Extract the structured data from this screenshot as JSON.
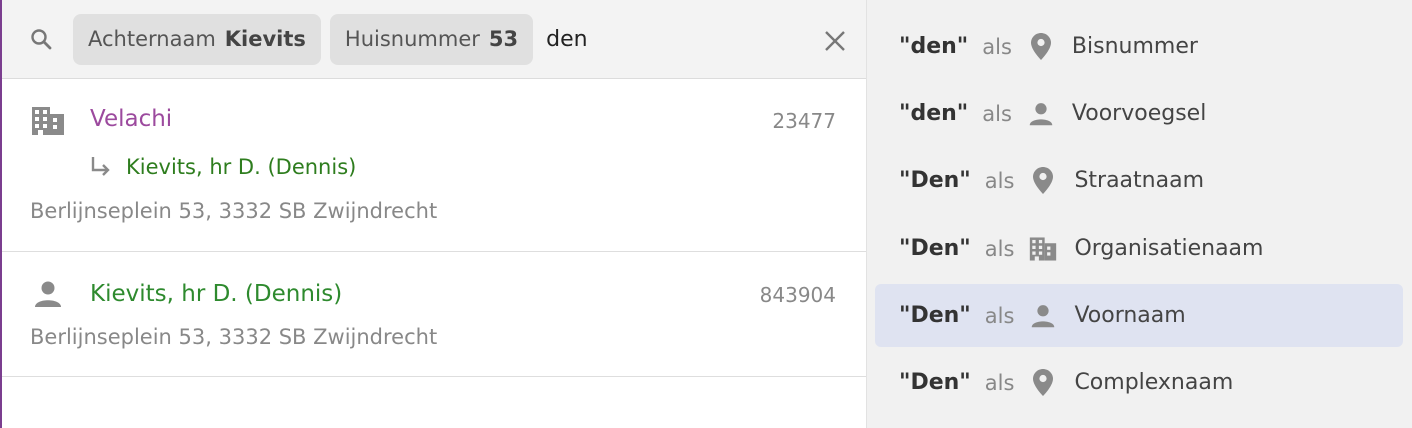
{
  "search": {
    "chips": [
      {
        "label": "Achternaam",
        "value": "Kievits"
      },
      {
        "label": "Huisnummer",
        "value": "53"
      }
    ],
    "query": "den"
  },
  "results": [
    {
      "icon": "building-icon",
      "title": "Velachi",
      "id": "23477",
      "contact": "Kievits, hr D. (Dennis)",
      "address": "Berlijnseplein 53, 3332 SB Zwijndrecht"
    },
    {
      "icon": "person-icon",
      "title": "Kievits, hr D. (Dennis)",
      "id": "843904",
      "address": "Berlijnseplein 53, 3332 SB Zwijndrecht"
    }
  ],
  "suggestions": [
    {
      "term": "\"den\"",
      "connector": "als",
      "icon": "location-pin-icon",
      "field": "Bisnummer"
    },
    {
      "term": "\"den\"",
      "connector": "als",
      "icon": "person-icon",
      "field": "Voorvoegsel"
    },
    {
      "term": "\"Den\"",
      "connector": "als",
      "icon": "location-pin-icon",
      "field": "Straatnaam"
    },
    {
      "term": "\"Den\"",
      "connector": "als",
      "icon": "building-icon",
      "field": "Organisatienaam"
    },
    {
      "term": "\"Den\"",
      "connector": "als",
      "icon": "person-icon",
      "field": "Voornaam",
      "active": true
    },
    {
      "term": "\"Den\"",
      "connector": "als",
      "icon": "location-pin-icon",
      "field": "Complexnaam"
    }
  ],
  "colors": {
    "organisation": "#9c4a9e",
    "person": "#2e8a2e",
    "active_suggestion": "#dfe3f1"
  }
}
